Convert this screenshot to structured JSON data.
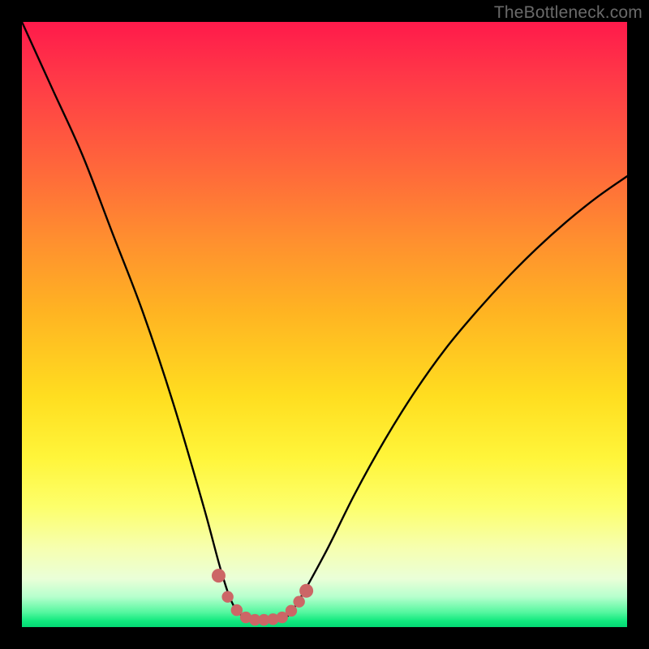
{
  "watermark": {
    "text": "TheBottleneck.com"
  },
  "chart_data": {
    "type": "line",
    "title": "",
    "xlabel": "",
    "ylabel": "",
    "xlim": [
      0,
      100
    ],
    "ylim": [
      0,
      100
    ],
    "grid": false,
    "legend": false,
    "series": [
      {
        "name": "bottleneck-curve",
        "x": [
          0,
          5,
          10,
          15,
          20,
          25,
          30,
          33,
          35,
          37,
          38,
          40,
          43,
          45,
          50,
          55,
          60,
          65,
          70,
          75,
          80,
          85,
          90,
          95,
          100
        ],
        "values": [
          100,
          89,
          78,
          65,
          52,
          37,
          20,
          9,
          3.5,
          1.5,
          1.2,
          1.2,
          1.5,
          3.2,
          12,
          22,
          31,
          39,
          46,
          52,
          57.5,
          62.5,
          67,
          71,
          74.5
        ]
      }
    ],
    "markers": {
      "name": "trough-markers",
      "color": "#cc6666",
      "points": [
        {
          "x": 32.5,
          "y": 8.5
        },
        {
          "x": 34.0,
          "y": 5.0
        },
        {
          "x": 35.5,
          "y": 2.8
        },
        {
          "x": 37.0,
          "y": 1.6
        },
        {
          "x": 38.5,
          "y": 1.2
        },
        {
          "x": 40.0,
          "y": 1.2
        },
        {
          "x": 41.5,
          "y": 1.3
        },
        {
          "x": 43.0,
          "y": 1.6
        },
        {
          "x": 44.5,
          "y": 2.7
        },
        {
          "x": 45.8,
          "y": 4.2
        },
        {
          "x": 47.0,
          "y": 6.0
        }
      ]
    },
    "background_gradient": {
      "stops": [
        {
          "pos": 0.0,
          "color": "#ff1a4b"
        },
        {
          "pos": 0.25,
          "color": "#ff6a3a"
        },
        {
          "pos": 0.5,
          "color": "#ffb422"
        },
        {
          "pos": 0.72,
          "color": "#fff53a"
        },
        {
          "pos": 0.9,
          "color": "#eaffd8"
        },
        {
          "pos": 1.0,
          "color": "#04d874"
        }
      ]
    }
  }
}
